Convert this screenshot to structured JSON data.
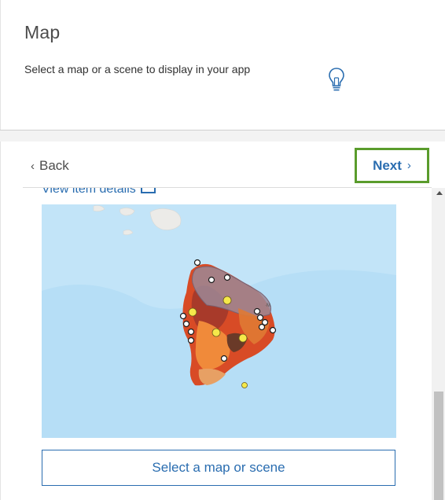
{
  "header": {
    "title": "Map",
    "description": "Select a map or a scene to display in your app",
    "tip_icon": "lightbulb-icon"
  },
  "nav": {
    "back_label": "Back",
    "back_icon": "chevron-left-icon",
    "next_label": "Next",
    "next_icon": "chevron-right-icon",
    "highlight_color": "#5a9c2c"
  },
  "content": {
    "view_details_label": "View item details",
    "map_thumbnail": "hawaii-island-map-thumbnail",
    "select_button_label": "Select a map or scene"
  },
  "colors": {
    "accent": "#2a6db0",
    "water": "#b6def6",
    "text": "#4c4c4c"
  }
}
